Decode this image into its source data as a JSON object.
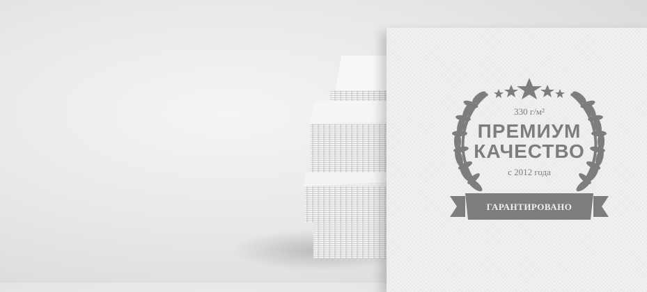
{
  "emblem": {
    "weight": "330 г/м²",
    "line1": "ПРЕМИУМ",
    "line2": "КАЧЕСТВО",
    "since": "с 2012 года",
    "ribbon": "ГАРАНТИРОВАНО",
    "icons": [
      "star-icon",
      "laurel-wreath-icon",
      "ribbon-banner-icon"
    ],
    "color": "#7d7d7d"
  }
}
